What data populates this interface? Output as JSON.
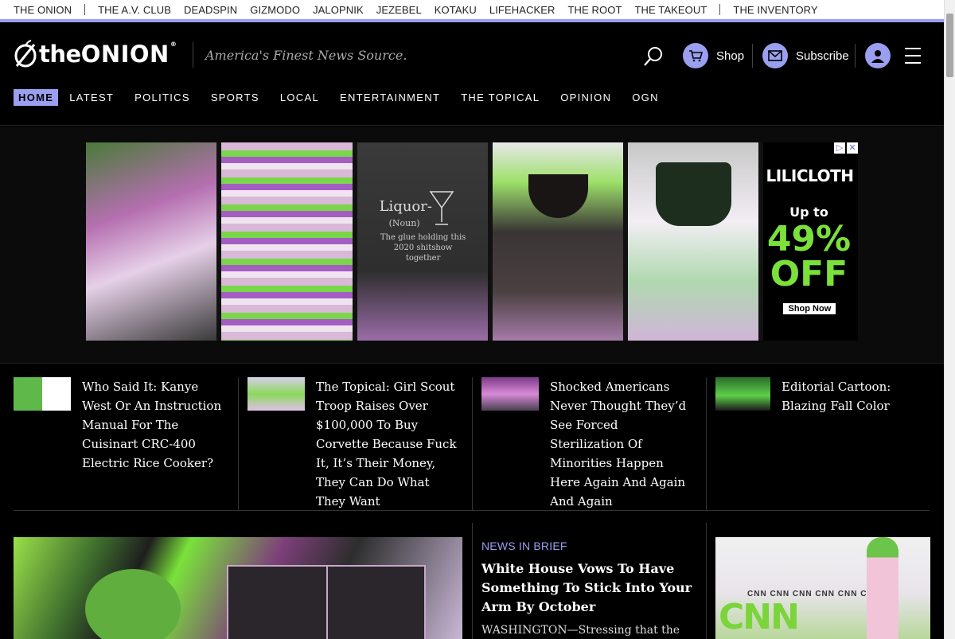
{
  "network": {
    "links": [
      "THE ONION",
      "THE A.V. CLUB",
      "DEADSPIN",
      "GIZMODO",
      "JALOPNIK",
      "JEZEBEL",
      "KOTAKU",
      "LIFEHACKER",
      "THE ROOT",
      "THE TAKEOUT",
      "THE INVENTORY"
    ]
  },
  "header": {
    "logo_the": "the",
    "logo_onion": "ONION",
    "logo_reg": "®",
    "tagline": "America's Finest News Source.",
    "shop_label": "Shop",
    "subscribe_label": "Subscribe"
  },
  "nav": {
    "items": [
      "HOME",
      "LATEST",
      "POLITICS",
      "SPORTS",
      "LOCAL",
      "ENTERTAINMENT",
      "THE TOPICAL",
      "OPINION",
      "OGN"
    ],
    "active": "HOME"
  },
  "ad": {
    "liquor": "Liquor-",
    "noun": "(Noun)",
    "glue": "The glue holding this 2020 shitshow together",
    "brand": "LILICLOTH",
    "up_to": "Up to",
    "discount": "49% OFF",
    "cta": "Shop Now",
    "choices_icon": "▷",
    "close_icon": "✕"
  },
  "headlines": [
    {
      "title": "Who Said It: Kanye West Or An Instruction Manual For The Cuisinart CRC-400 Electric Rice Cooker?"
    },
    {
      "title": "The Topical: Girl Scout Troop Raises Over $100,000 To Buy Corvette Because Fuck It, It’s Their Money, They Can Do What They Want"
    },
    {
      "title": "Shocked Americans Never Thought They’d See Forced Sterilization Of Minorities Happen Here Again And Again And Again"
    },
    {
      "title": "Editorial Cartoon: Blazing Fall Color"
    }
  ],
  "brief": {
    "kicker": "NEWS IN BRIEF",
    "title": "White House Vows To Have Something To Stick Into Your Arm By October",
    "body": "WASHINGTON—Stressing that the"
  },
  "cnn": {
    "logo": "CNN",
    "strip": "CNN CNN CNN CNN CNN CNN"
  },
  "colors": {
    "accent": "#9a9ff0",
    "background": "#000000"
  }
}
